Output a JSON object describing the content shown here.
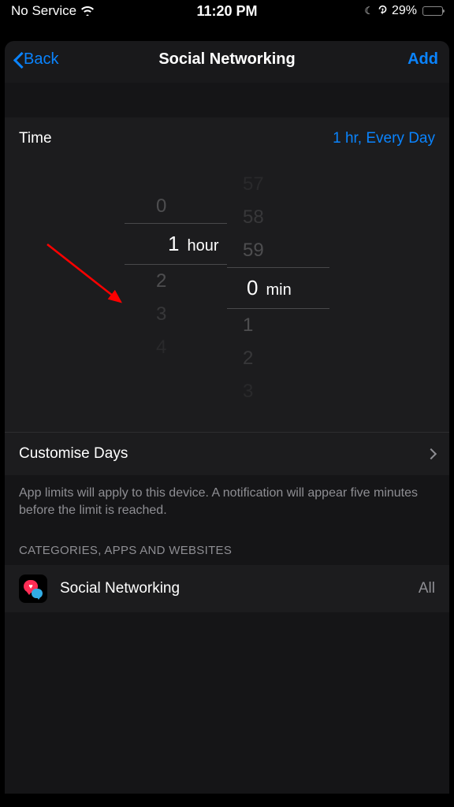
{
  "statusBar": {
    "service": "No Service",
    "time": "11:20 PM",
    "batteryPercent": "29%"
  },
  "nav": {
    "back": "Back",
    "title": "Social Networking",
    "add": "Add"
  },
  "timeSection": {
    "label": "Time",
    "value": "1 hr, Every Day",
    "picker": {
      "hours": {
        "prev3": "",
        "prev2": "",
        "prev1": "0",
        "selected": "1",
        "label": "hour",
        "next1": "2",
        "next2": "3",
        "next3": "4"
      },
      "mins": {
        "prev3": "57",
        "prev2": "58",
        "prev1": "59",
        "selected": "0",
        "label": "min",
        "next1": "1",
        "next2": "2",
        "next3": "3"
      }
    }
  },
  "customise": {
    "label": "Customise Days"
  },
  "footerText": "App limits will apply to this device. A notification will appear five minutes before the limit is reached.",
  "categoriesHeader": "CATEGORIES, APPS AND WEBSITES",
  "category": {
    "name": "Social Networking",
    "count": "All"
  }
}
